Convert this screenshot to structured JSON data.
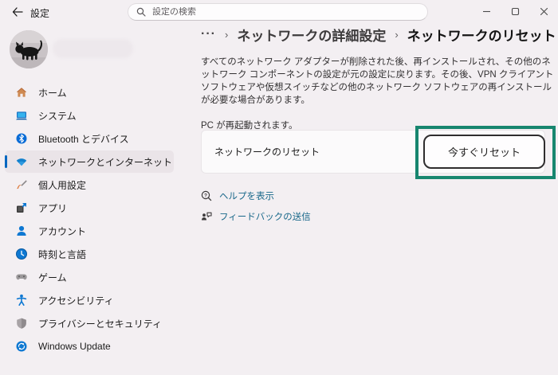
{
  "window": {
    "title": "設定",
    "controls": {
      "minimize": "minimize",
      "maximize": "maximize",
      "close": "close"
    }
  },
  "search": {
    "placeholder": "設定の検索"
  },
  "sidebar": {
    "items": [
      {
        "label": "ホーム",
        "icon": "home-icon",
        "selected": false
      },
      {
        "label": "システム",
        "icon": "system-icon",
        "selected": false
      },
      {
        "label": "Bluetooth とデバイス",
        "icon": "bluetooth-icon",
        "selected": false
      },
      {
        "label": "ネットワークとインターネット",
        "icon": "network-icon",
        "selected": true
      },
      {
        "label": "個人用設定",
        "icon": "personalization-icon",
        "selected": false
      },
      {
        "label": "アプリ",
        "icon": "apps-icon",
        "selected": false
      },
      {
        "label": "アカウント",
        "icon": "accounts-icon",
        "selected": false
      },
      {
        "label": "時刻と言語",
        "icon": "time-language-icon",
        "selected": false
      },
      {
        "label": "ゲーム",
        "icon": "gaming-icon",
        "selected": false
      },
      {
        "label": "アクセシビリティ",
        "icon": "accessibility-icon",
        "selected": false
      },
      {
        "label": "プライバシーとセキュリティ",
        "icon": "privacy-icon",
        "selected": false
      },
      {
        "label": "Windows Update",
        "icon": "windows-update-icon",
        "selected": false
      }
    ]
  },
  "breadcrumb": {
    "ellipsis": "···",
    "separator": "›",
    "parent": "ネットワークの詳細設定",
    "current": "ネットワークのリセット"
  },
  "main": {
    "description": "すべてのネットワーク アダプターが削除された後、再インストールされ、その他のネットワーク コンポーネントの設定が元の設定に戻ります。その後、VPN クライアント ソフトウェアや仮想スイッチなどの他のネットワーク ソフトウェアの再インストールが必要な場合があります。",
    "restart_note": "PC が再起動されます。",
    "reset_card": {
      "label": "ネットワークのリセット",
      "button_label": "今すぐリセット"
    },
    "links": [
      {
        "label": "ヘルプを表示",
        "icon": "help-icon"
      },
      {
        "label": "フィードバックの送信",
        "icon": "feedback-icon"
      }
    ]
  },
  "colors": {
    "accent": "#0067c0",
    "highlight_box": "#17866f",
    "link": "#19688a",
    "background": "#f3eff2",
    "card_background": "#fbfafb"
  }
}
